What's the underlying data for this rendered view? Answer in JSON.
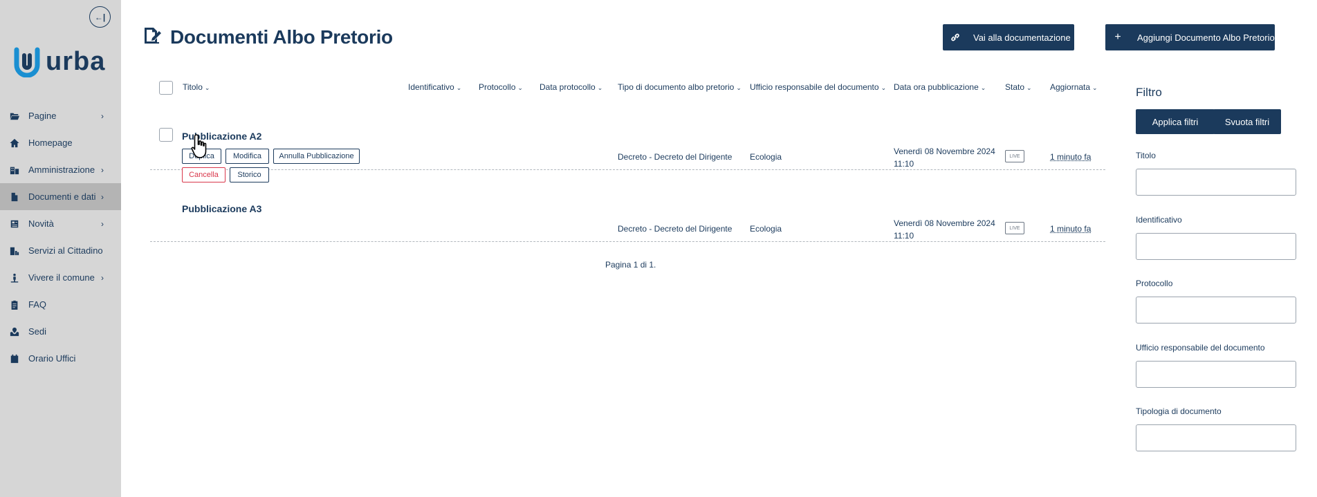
{
  "sidebar": {
    "logo_text": "urba",
    "collapse_label": "←|",
    "items": [
      {
        "label": "Pagine",
        "icon": "folder-open-icon",
        "has_children": true
      },
      {
        "label": "Homepage",
        "icon": "home-icon",
        "has_children": false
      },
      {
        "label": "Amministrazione",
        "icon": "building-icon",
        "has_children": true
      },
      {
        "label": "Documenti e dati",
        "icon": "file-icon",
        "has_children": true,
        "active": true
      },
      {
        "label": "Novità",
        "icon": "newspaper-icon",
        "has_children": true
      },
      {
        "label": "Servizi al Cittadino",
        "icon": "city-services-icon",
        "has_children": false
      },
      {
        "label": "Vivere il comune",
        "icon": "person-icon",
        "has_children": true
      },
      {
        "label": "FAQ",
        "icon": "clipboard-icon",
        "has_children": false
      },
      {
        "label": "Sedi",
        "icon": "map-location-icon",
        "has_children": false
      },
      {
        "label": "Orario Uffici",
        "icon": "calendar-icon",
        "has_children": false
      }
    ],
    "chevron": "›"
  },
  "header": {
    "title": "Documenti Albo Pretorio",
    "doc_button": "Vai alla documentazione",
    "add_button": "Aggiungi Documento Albo Pretorio",
    "add_icon": "+"
  },
  "table": {
    "columns": [
      "Titolo",
      "Identificativo",
      "Protocollo",
      "Data protocollo",
      "Tipo di documento albo pretorio",
      "Ufficio responsabile del documento",
      "Data ora pubblicazione",
      "Stato",
      "Aggiornata"
    ],
    "caret": "⌄",
    "rows": [
      {
        "title": "Pubblicazione A2",
        "actions": [
          "Duplica",
          "Modifica",
          "Annulla Pubblicazione",
          "Cancella",
          "Storico"
        ],
        "tipo": "Decreto - Decreto del Dirigente",
        "ufficio": "Ecologia",
        "data_line1": "Venerdì 08 Novembre 2024",
        "data_line2": "11:10",
        "stato": "LIVE",
        "aggiornata": "1 minuto fa"
      },
      {
        "title": "Pubblicazione A3",
        "tipo": "Decreto - Decreto del Dirigente",
        "ufficio": "Ecologia",
        "data_line1": "Venerdì 08 Novembre 2024",
        "data_line2": "11:10",
        "stato": "LIVE",
        "aggiornata": "1 minuto fa"
      }
    ],
    "pagination": "Pagina 1 di 1."
  },
  "filters": {
    "title": "Filtro",
    "apply": "Applica filtri",
    "clear": "Svuota filtri",
    "fields": [
      {
        "label": "Titolo",
        "value": ""
      },
      {
        "label": "Identificativo",
        "value": ""
      },
      {
        "label": "Protocollo",
        "value": ""
      },
      {
        "label": "Ufficio responsabile del documento",
        "value": ""
      },
      {
        "label": "Tipologia di documento",
        "value": ""
      }
    ]
  },
  "colors": {
    "primary": "#1b3a5c",
    "sidebar_bg": "#d6d6d6",
    "sidebar_active": "#b4b4b4",
    "danger": "#d9364a",
    "logo_accent": "#1a8fd1"
  }
}
